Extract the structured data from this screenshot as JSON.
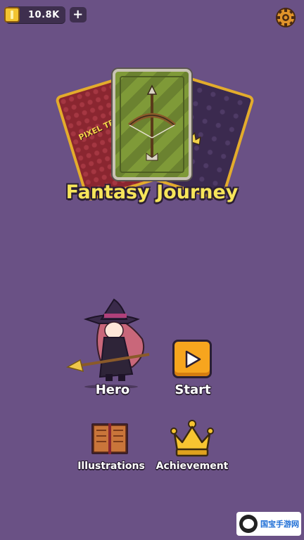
{
  "currency": {
    "value": "10.8K",
    "add_label": "+",
    "coin_color": "#f3c431"
  },
  "settings": {
    "icon": "gear-icon"
  },
  "title": "Fantasy Journey",
  "cards": {
    "left_text": "PIXEL TF",
    "center_icon": "crossbow-icon",
    "right_icon": "crown-icon"
  },
  "menu": {
    "hero_label": "Hero",
    "start_label": "Start",
    "illustrations_label": "Illustrations",
    "achievement_label": "Achievement"
  },
  "watermark": {
    "text": "国宝手游网"
  },
  "colors": {
    "background": "#6a5185",
    "title": "#f6e55a",
    "start_button": "#f7a51e",
    "card_border_gold": "#e3ac2c"
  }
}
